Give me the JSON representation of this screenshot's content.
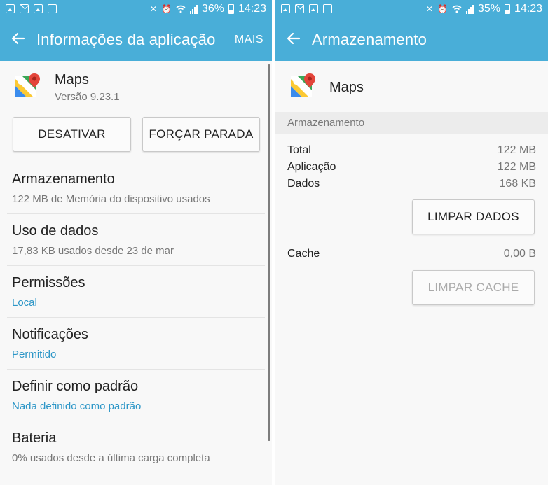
{
  "status_left": {
    "battery": "36%",
    "time": "14:23"
  },
  "status_right": {
    "battery": "35%",
    "time": "14:23"
  },
  "left": {
    "title": "Informações da aplicação",
    "action": "MAIS",
    "app": {
      "name": "Maps",
      "version": "Versão 9.23.1"
    },
    "buttons": {
      "disable": "DESATIVAR",
      "force_stop": "FORÇAR PARADA"
    },
    "items": [
      {
        "title": "Armazenamento",
        "subtitle": "122 MB de Memória do dispositivo usados"
      },
      {
        "title": "Uso de dados",
        "subtitle": "17,83 KB usados desde 23 de mar"
      },
      {
        "title": "Permissões",
        "subtitle": "Local"
      },
      {
        "title": "Notificações",
        "subtitle": "Permitido"
      },
      {
        "title": "Definir como padrão",
        "subtitle": "Nada definido como padrão"
      },
      {
        "title": "Bateria",
        "subtitle": "0% usados desde a última carga completa"
      }
    ]
  },
  "right": {
    "title": "Armazenamento",
    "app": {
      "name": "Maps"
    },
    "section": "Armazenamento",
    "rows": [
      {
        "label": "Total",
        "value": "122 MB"
      },
      {
        "label": "Aplicação",
        "value": "122 MB"
      },
      {
        "label": "Dados",
        "value": "168 KB"
      }
    ],
    "clear_data": "LIMPAR DADOS",
    "cache": {
      "label": "Cache",
      "value": "0,00 B"
    },
    "clear_cache": "LIMPAR CACHE"
  },
  "colors": {
    "accent": "#49aed8",
    "link": "#2c96c7"
  },
  "icons": [
    "back-arrow-icon",
    "maps-app-icon",
    "gallery-notification-icon",
    "mail-notification-icon",
    "mute-icon",
    "alarm-icon",
    "wifi-icon",
    "signal-icon",
    "battery-icon"
  ]
}
